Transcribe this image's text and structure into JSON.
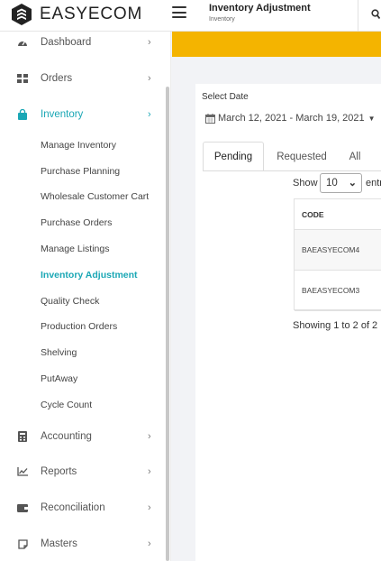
{
  "brand": {
    "name": "EASYECOM"
  },
  "header": {
    "title": "Inventory Adjustment",
    "subtitle": "Inventory"
  },
  "sidebar": {
    "top_items": [
      {
        "label": "Dashboard",
        "icon": "dashboard-icon"
      },
      {
        "label": "Orders",
        "icon": "grid-icon"
      },
      {
        "label": "Inventory",
        "icon": "bag-icon",
        "active": true
      }
    ],
    "inventory_sub": [
      "Manage Inventory",
      "Purchase Planning",
      "Wholesale Customer Cart",
      "Purchase Orders",
      "Manage Listings",
      "Inventory Adjustment",
      "Quality Check",
      "Production Orders",
      "Shelving",
      "PutAway",
      "Cycle Count"
    ],
    "bottom_items": [
      {
        "label": "Accounting",
        "icon": "calculator-icon"
      },
      {
        "label": "Reports",
        "icon": "chart-line-icon"
      },
      {
        "label": "Reconciliation",
        "icon": "wallet-icon"
      },
      {
        "label": "Masters",
        "icon": "note-icon"
      }
    ]
  },
  "main": {
    "select_date_label": "Select Date",
    "date_range": "March 12, 2021 - March 19, 2021",
    "tabs": [
      "Pending",
      "Requested",
      "All"
    ],
    "show_label": "Show",
    "show_value": "10",
    "entries_label": "entr",
    "table": {
      "header": "CODE",
      "rows": [
        "BAEASYECOM4",
        "BAEASYECOM3"
      ]
    },
    "showing_text": "Showing 1 to 2 of 2"
  },
  "colors": {
    "accent": "#1aa7b5",
    "banner": "#f4b400"
  }
}
